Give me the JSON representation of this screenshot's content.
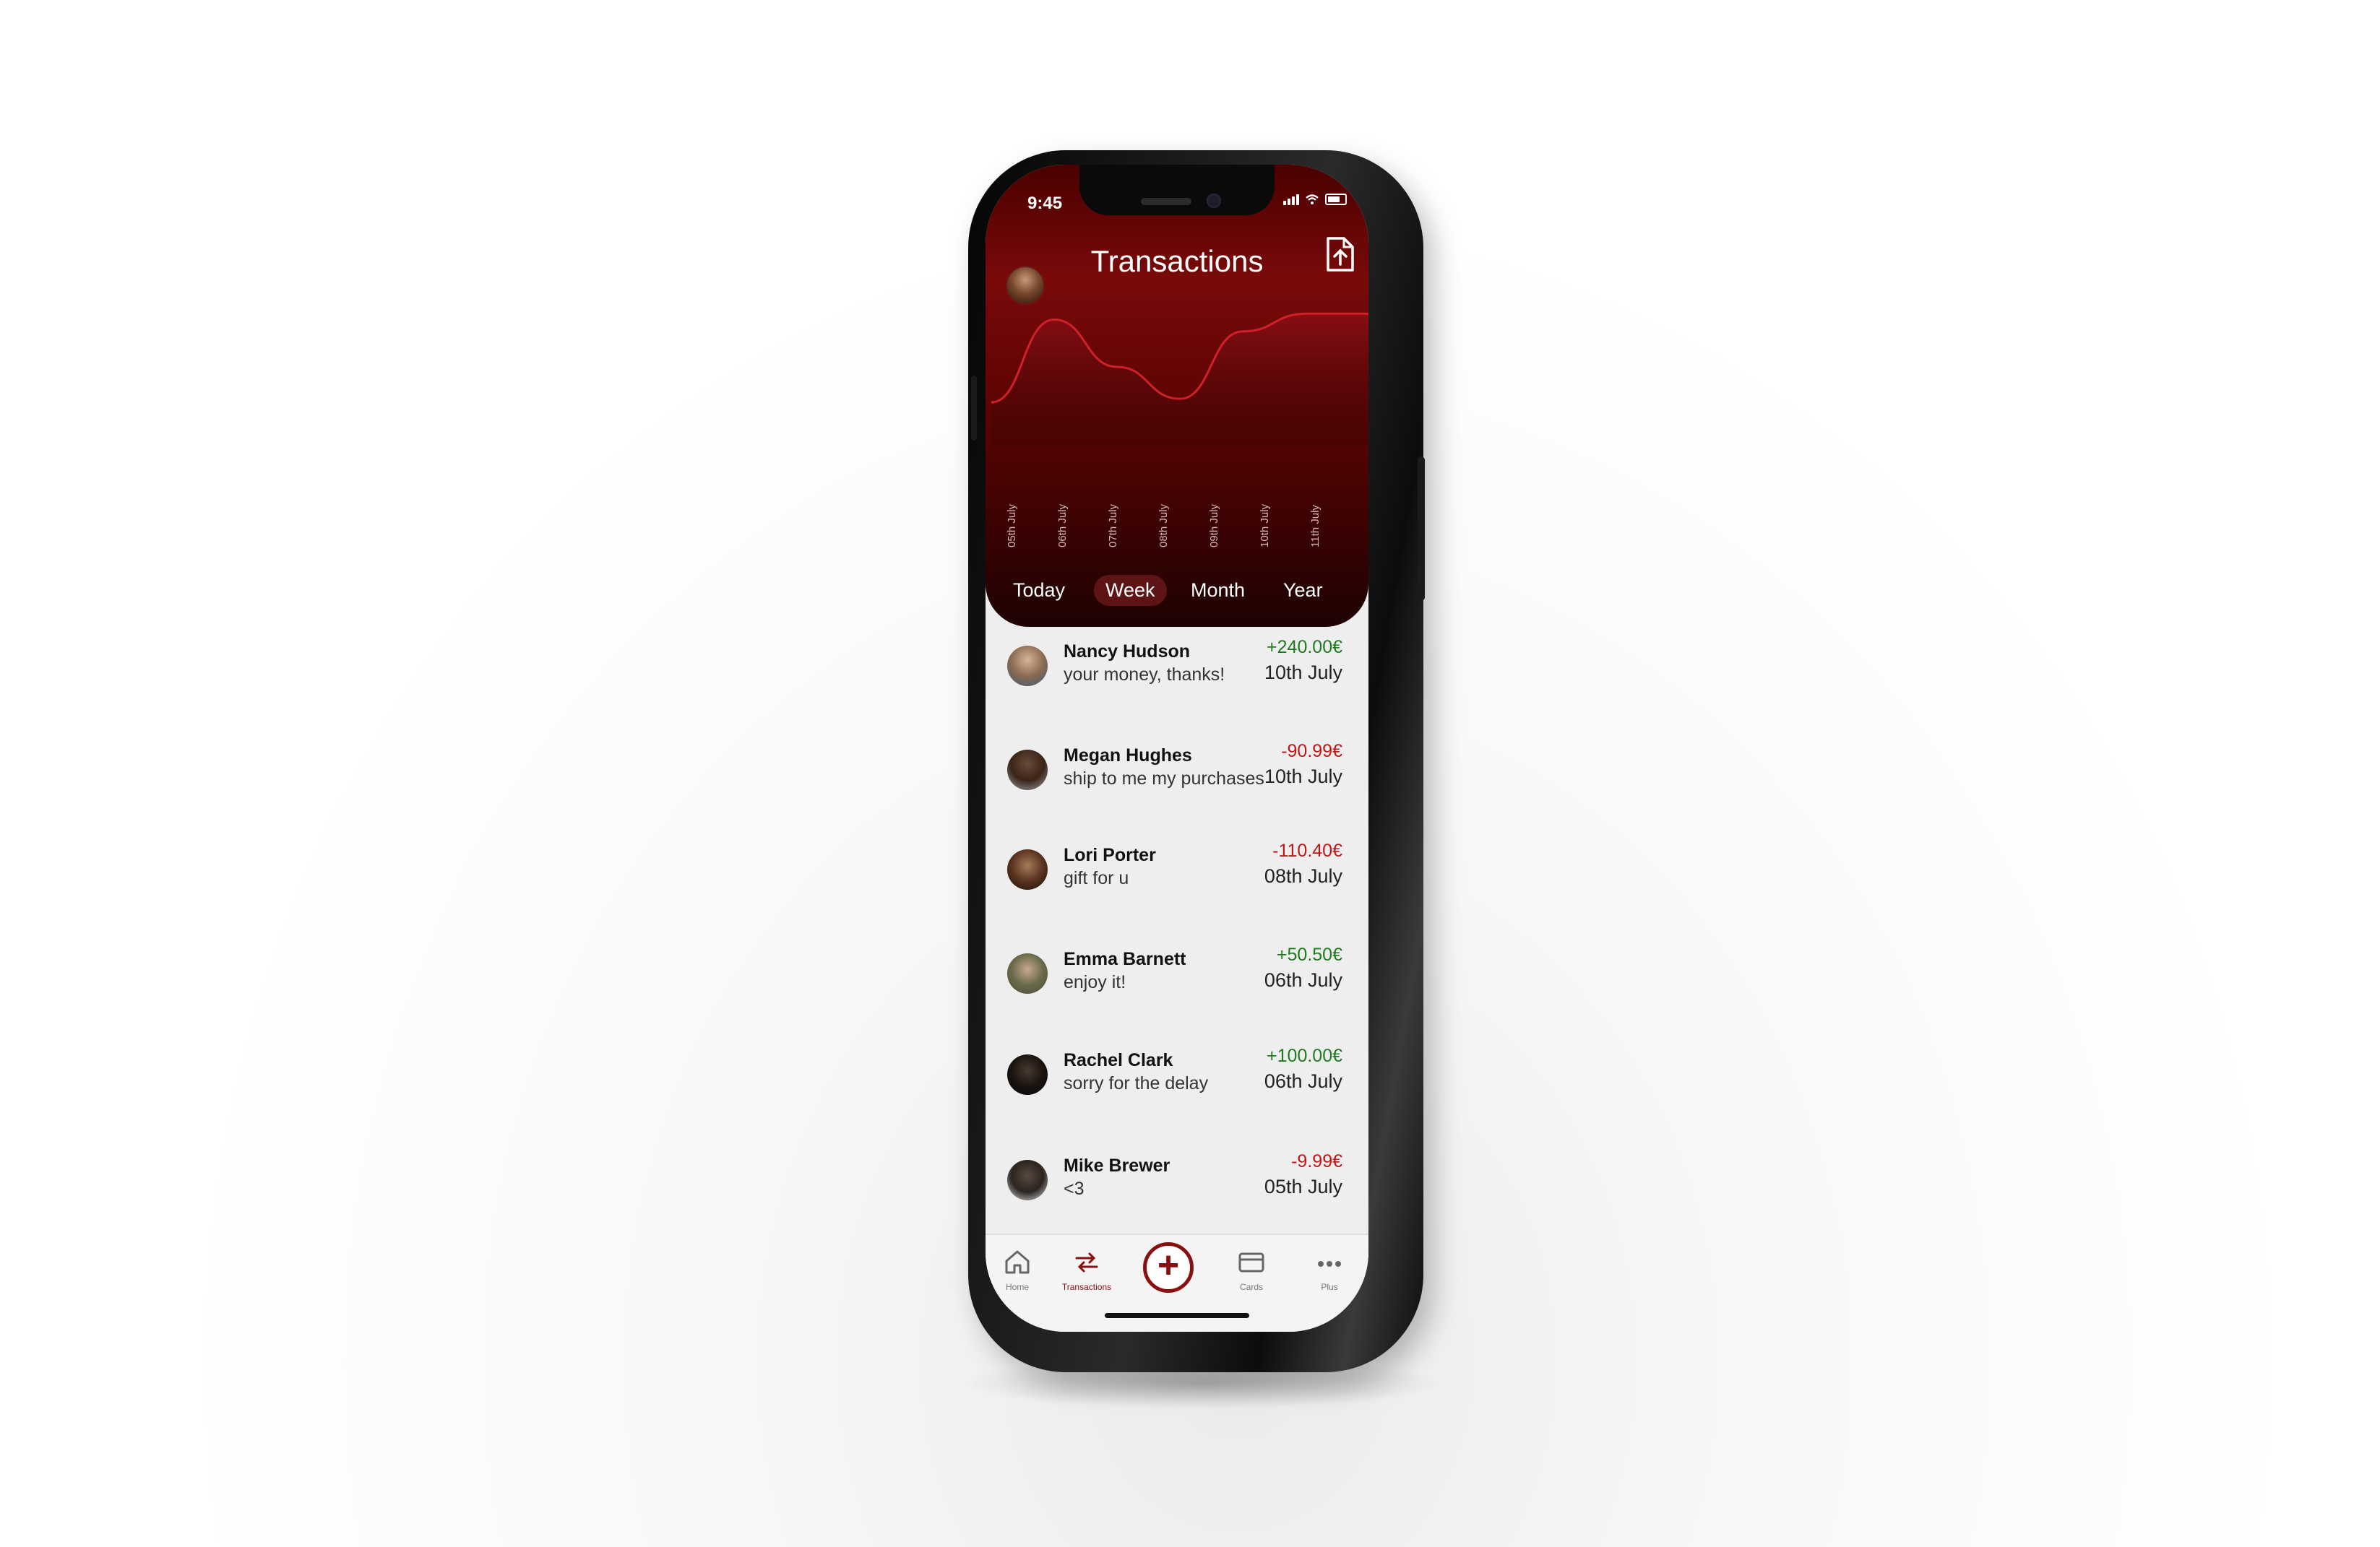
{
  "status_bar": {
    "time": "9:45",
    "icons": [
      "signal-icon",
      "wifi-icon",
      "battery-icon"
    ]
  },
  "header": {
    "title": "Transactions",
    "profile_avatar": "profile-avatar",
    "export_icon": "file-export-icon"
  },
  "chart_data": {
    "type": "area",
    "x": [
      "05th July",
      "06th July",
      "07th July",
      "08th July",
      "09th July",
      "10th July",
      "11th July"
    ],
    "values": [
      0.25,
      0.95,
      0.55,
      0.28,
      0.85,
      1.0,
      1.0
    ],
    "title": "",
    "xlabel": "",
    "ylabel": "",
    "ylim": [
      0,
      1.1
    ],
    "grid": false,
    "colors": {
      "line": "#d0202a",
      "fill": "#8a0e14"
    }
  },
  "period_tabs": [
    {
      "label": "Today",
      "active": false
    },
    {
      "label": "Week",
      "active": true
    },
    {
      "label": "Month",
      "active": false
    },
    {
      "label": "Year",
      "active": false
    }
  ],
  "transactions": [
    {
      "name": "Nancy Hudson",
      "message": "your money, thanks!",
      "amount": "+240.00€",
      "date": "10th July",
      "direction": "in"
    },
    {
      "name": "Megan Hughes",
      "message": "ship to me my purchases",
      "amount": "-90.99€",
      "date": "10th July",
      "direction": "out"
    },
    {
      "name": "Lori Porter",
      "message": "gift for u",
      "amount": "-110.40€",
      "date": "08th July",
      "direction": "out"
    },
    {
      "name": "Emma Barnett",
      "message": "enjoy it!",
      "amount": "+50.50€",
      "date": "06th July",
      "direction": "in"
    },
    {
      "name": "Rachel Clark",
      "message": "sorry for the delay",
      "amount": "+100.00€",
      "date": "06th July",
      "direction": "in"
    },
    {
      "name": "Mike Brewer",
      "message": "<3",
      "amount": "-9.99€",
      "date": "05th July",
      "direction": "out"
    }
  ],
  "tab_bar": {
    "home": "Home",
    "transactions": "Transactions",
    "add_symbol": "+",
    "cards": "Cards",
    "more": "Plus"
  },
  "colors": {
    "brand": "#8a0f0f",
    "positive": "#1e7a1e",
    "negative": "#c01616"
  }
}
